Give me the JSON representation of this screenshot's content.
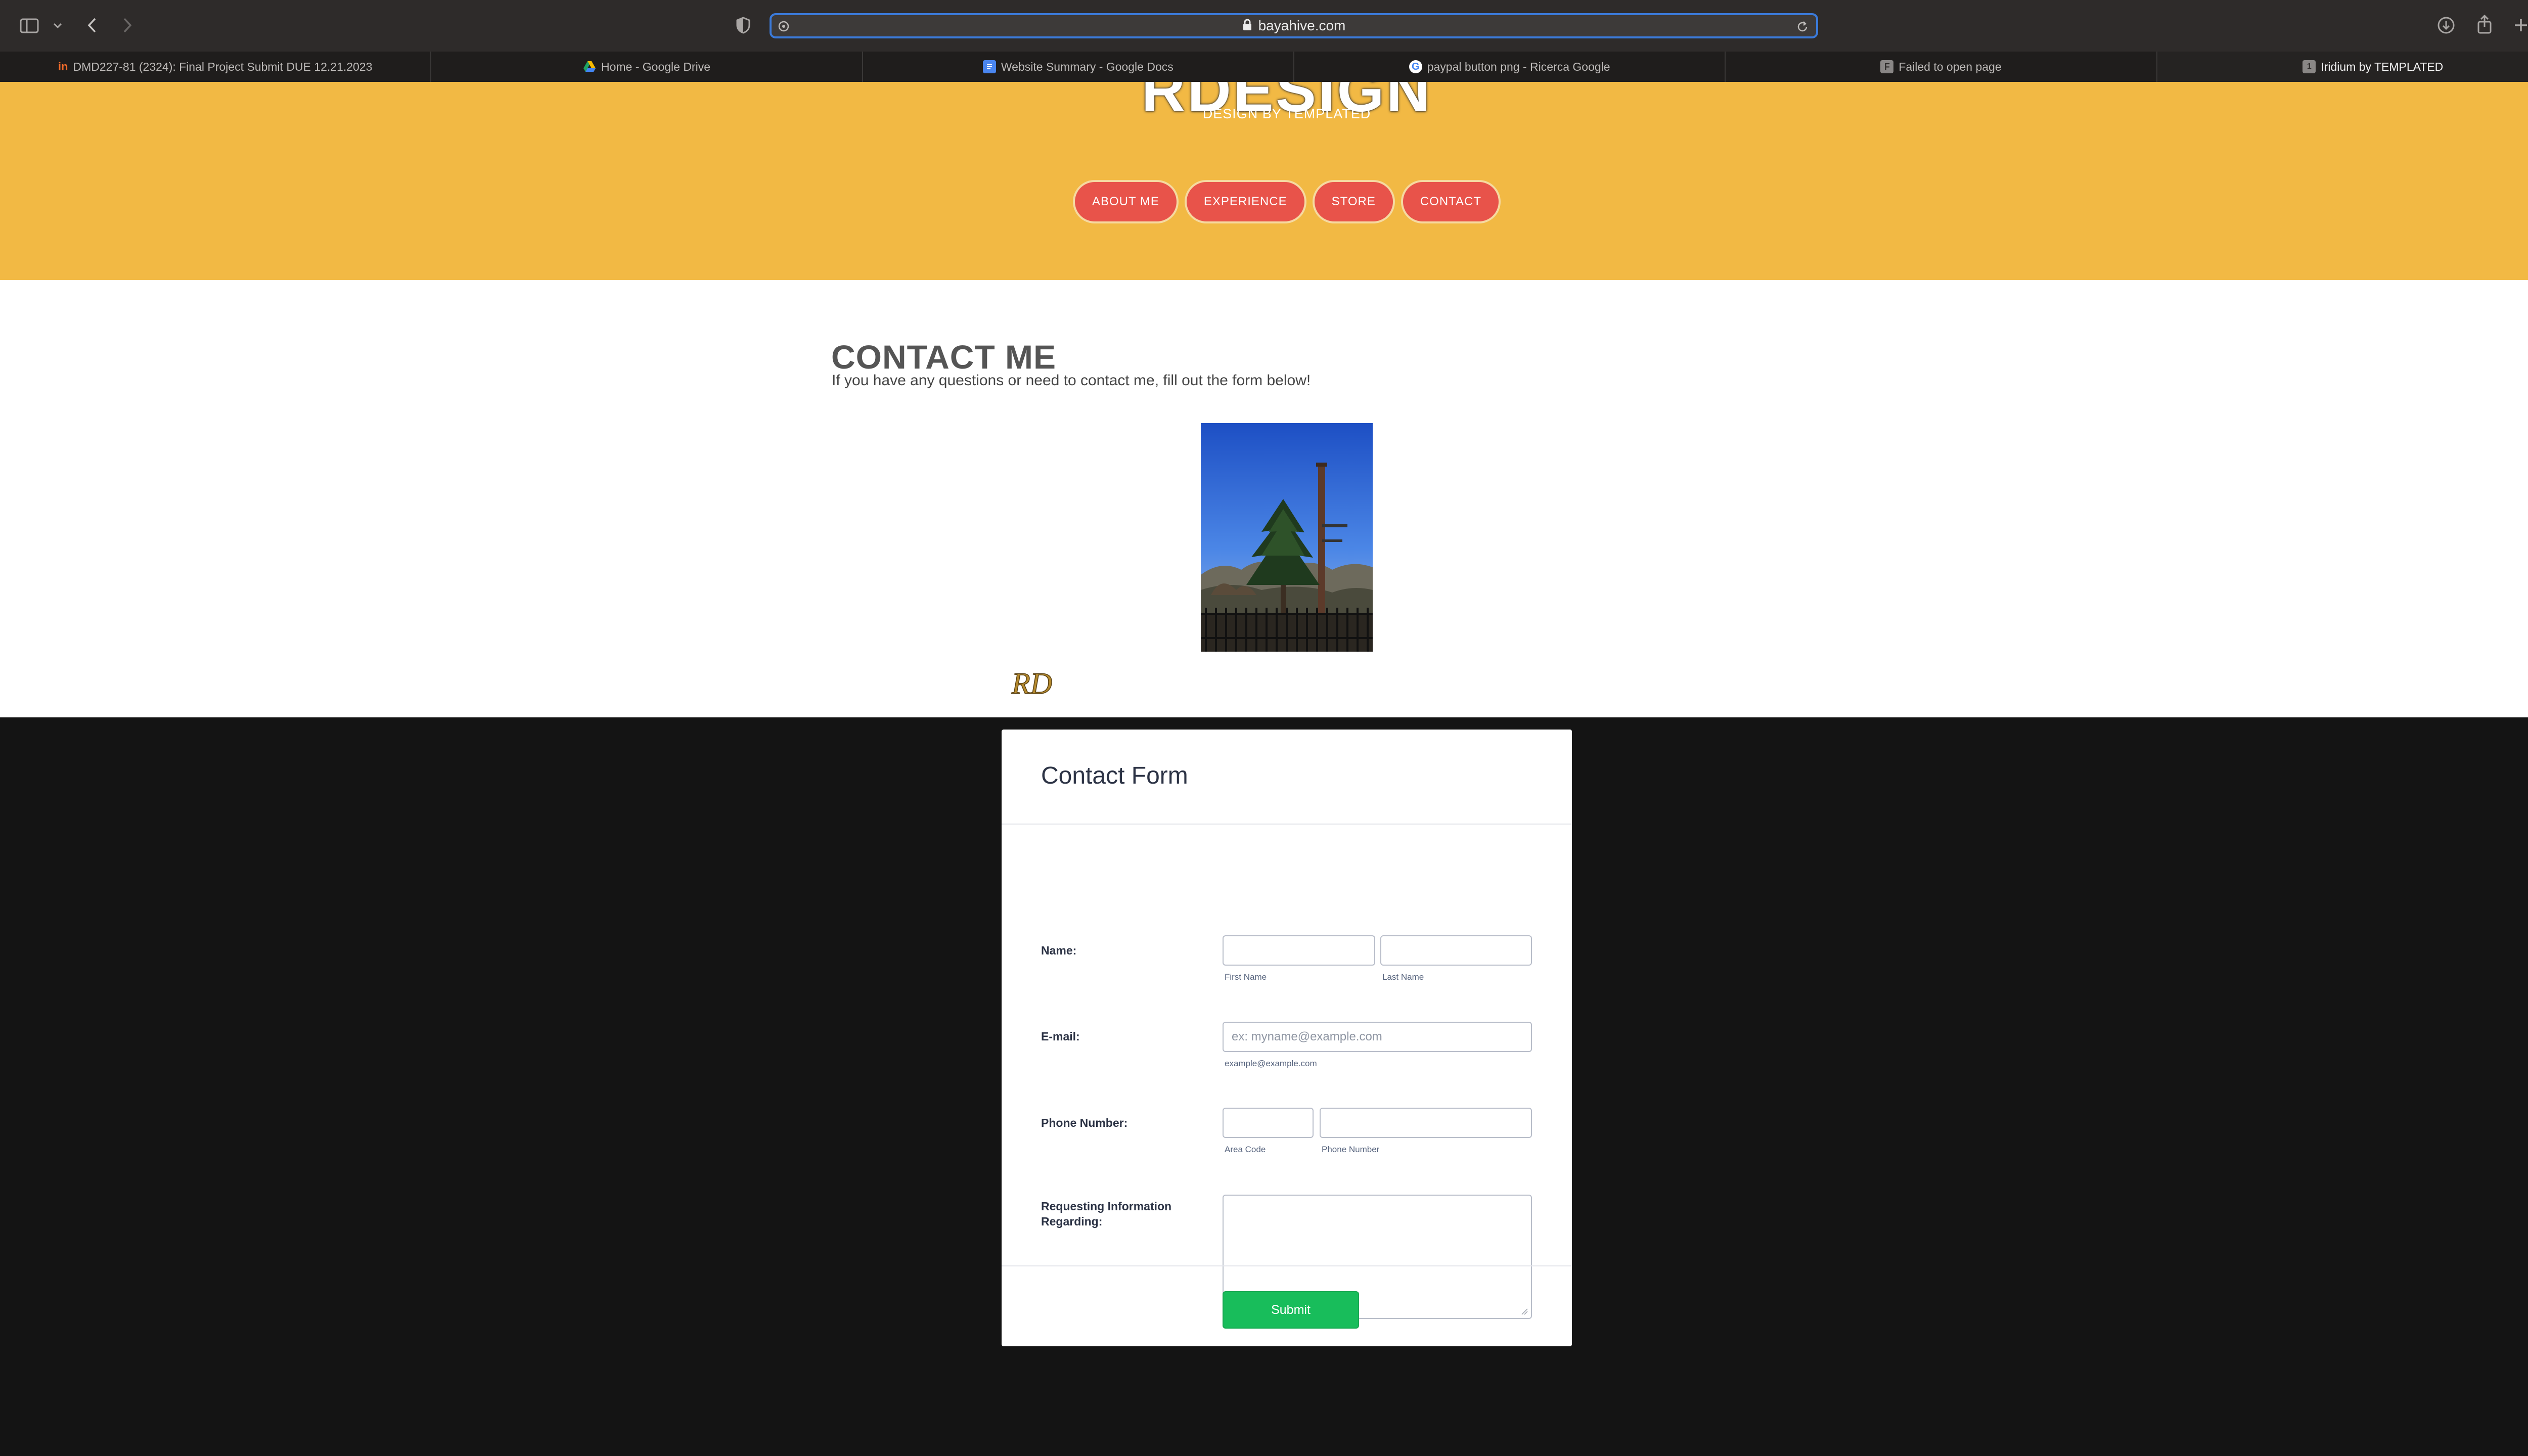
{
  "browser": {
    "url": "bayahive.com",
    "tabs": [
      {
        "label": "DMD227-81 (2324): Final Project Submit DUE 12.21.2023",
        "icon": "invision-icon",
        "active": false
      },
      {
        "label": "Home - Google Drive",
        "icon": "google-drive-icon",
        "active": false
      },
      {
        "label": "Website Summary - Google Docs",
        "icon": "google-docs-icon",
        "active": false
      },
      {
        "label": "paypal button png - Ricerca Google",
        "icon": "google-icon",
        "active": false
      },
      {
        "label": "Failed to open page",
        "icon": "letter-f-icon",
        "active": false
      },
      {
        "label": "Iridium by TEMPLATED",
        "icon": "site-icon",
        "active": true
      }
    ]
  },
  "header": {
    "logo": "RDESIGN",
    "subtitle": "DESIGN BY TEMPLATED",
    "nav": [
      "ABOUT ME",
      "EXPERIENCE",
      "STORE",
      "CONTACT"
    ],
    "bg_color": "#f2b944",
    "button_color": "#e8534a"
  },
  "contact": {
    "title": "CONTACT ME",
    "description": "If you have any questions or need to contact me, fill out the form below!"
  },
  "footer": {
    "logo_text": "RD"
  },
  "form": {
    "title": "Contact Form",
    "name_label": "Name:",
    "first_name_sub": "First Name",
    "last_name_sub": "Last Name",
    "email_label": "E-mail:",
    "email_placeholder": "ex: myname@example.com",
    "email_sub": "example@example.com",
    "phone_label": "Phone Number:",
    "area_code_sub": "Area Code",
    "phone_number_sub": "Phone Number",
    "request_label": "Requesting Information Regarding:",
    "submit_label": "Submit",
    "submit_color": "#18bd5b"
  }
}
